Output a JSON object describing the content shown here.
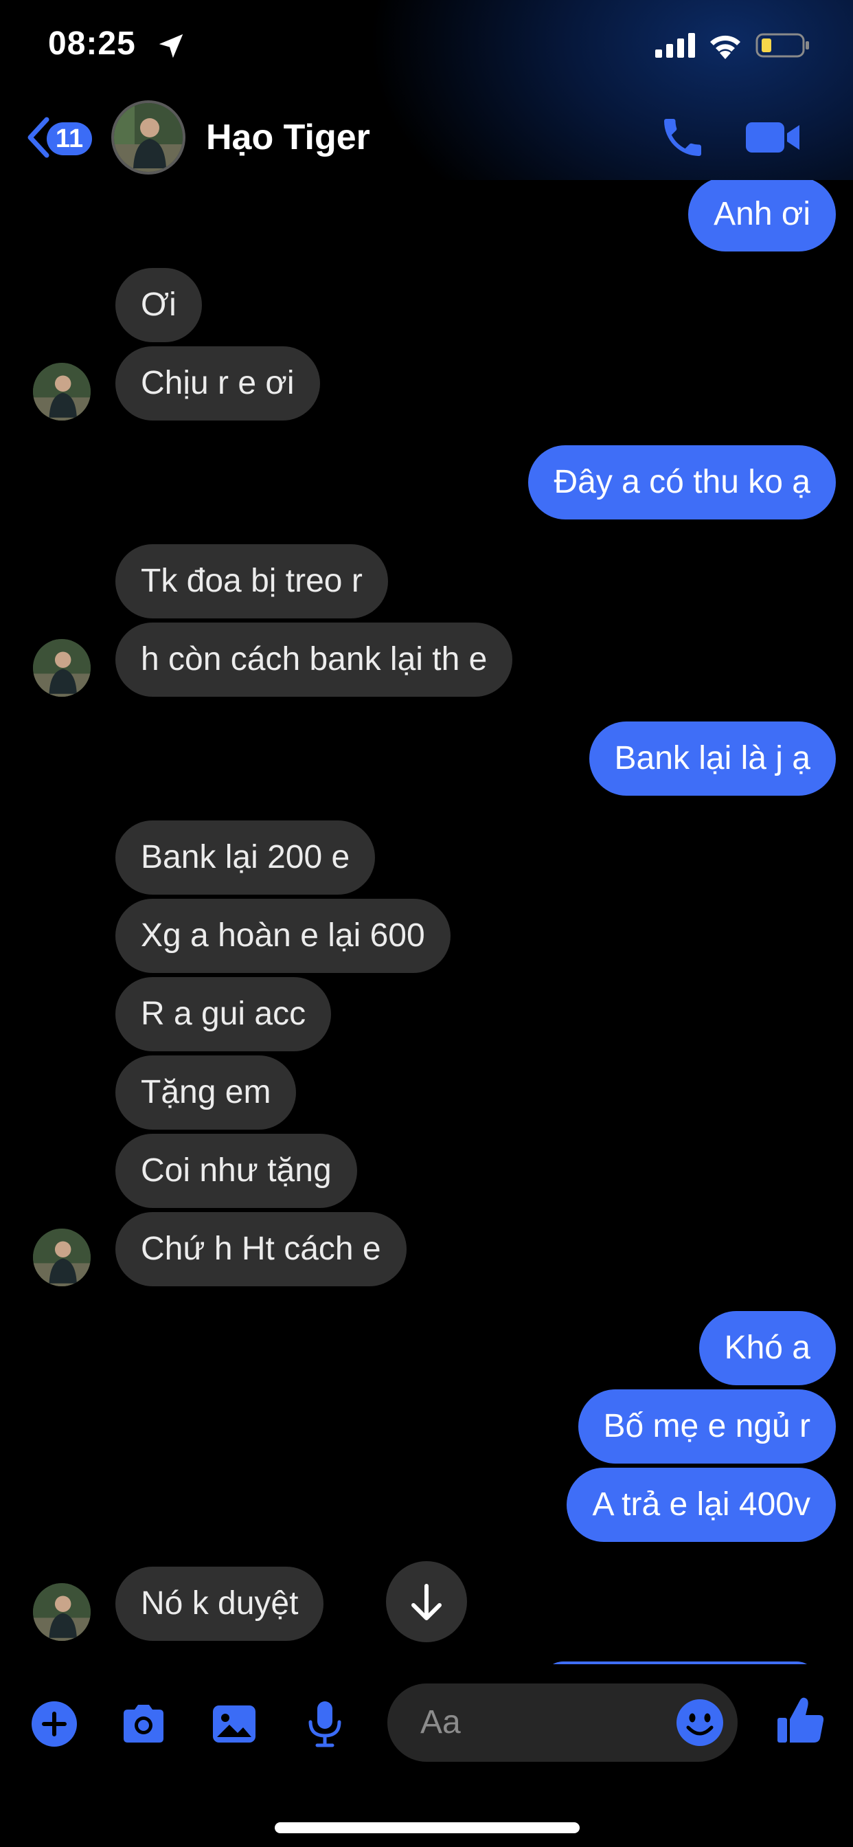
{
  "status_bar": {
    "time": "08:25",
    "icons": [
      "location-arrow-icon",
      "cellular-signal-icon",
      "wifi-icon",
      "battery-low-icon"
    ]
  },
  "nav": {
    "back_badge": "11",
    "contact_name": "Hạo Tiger",
    "accent_color": "#3b6cf6",
    "actions": [
      "phone-icon",
      "video-camera-icon"
    ]
  },
  "messages": [
    {
      "from": "me",
      "text": "Anh ơi"
    },
    {
      "from": "them",
      "text": "Ơi"
    },
    {
      "from": "them",
      "text": "Chịu r  e ơi"
    },
    {
      "from": "me",
      "text": "Đây a có thu ko ạ"
    },
    {
      "from": "them",
      "text": "Tk đoa bị treo r"
    },
    {
      "from": "them",
      "text": "h còn cách bank lại th e"
    },
    {
      "from": "me",
      "text": "Bank lại là j ạ"
    },
    {
      "from": "them",
      "text": "Bank lại 200 e"
    },
    {
      "from": "them",
      "text": "Xg a hoàn e lại 600"
    },
    {
      "from": "them",
      "text": "R a gui acc"
    },
    {
      "from": "them",
      "text": "Tặng em"
    },
    {
      "from": "them",
      "text": "Coi như tặng"
    },
    {
      "from": "them",
      "text": "Chứ h Ht cách e"
    },
    {
      "from": "me",
      "text": "Khó a"
    },
    {
      "from": "me",
      "text": "Bố mẹ e ngủ r"
    },
    {
      "from": "me",
      "text": "A trả e lại 400v"
    },
    {
      "from": "them",
      "text": "Nó k duyệt"
    }
  ],
  "composer": {
    "placeholder": "Aa",
    "tools": [
      "plus-icon",
      "camera-icon",
      "photo-icon",
      "microphone-icon"
    ],
    "emoji_icon": "smiley-icon",
    "send_icon": "thumbs-up-icon"
  },
  "colors": {
    "outgoing_bubble": "#3f6ef7",
    "incoming_bubble": "#303030",
    "background": "#000000"
  }
}
